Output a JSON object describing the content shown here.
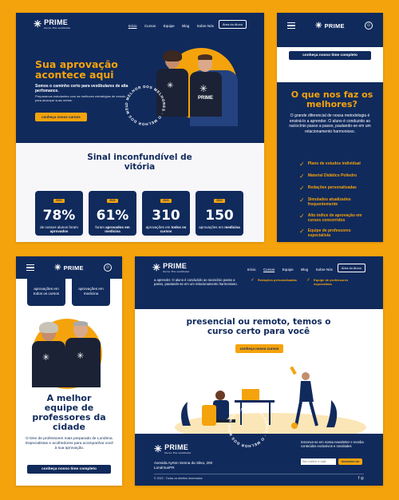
{
  "brand": {
    "name": "PRIME",
    "tagline": "Curso Pré-vestibular",
    "star": "✳"
  },
  "nav": {
    "items": [
      "Início",
      "Cursos",
      "Equipe",
      "Blog",
      "Sobre Nós"
    ],
    "cta": "Área do Aluno"
  },
  "hero": {
    "title": "Sua aprovação acontece aqui",
    "subtitle": "Somos o caminho certo para vestibulares de alta perfomance.",
    "desc": "Preparamos estudantes com as melhores estratégias de estudo para alcançar suas metas.",
    "button": "conheça nosso cursos",
    "ring_text": "O MELHOR DOS MELHORES · O MELHOR DOS MELHORES ·"
  },
  "stats": {
    "title": "Sinal inconfundível de vitória",
    "items": [
      {
        "year": "2021",
        "number": "78%",
        "caption_pre": "de nossos alunos foram",
        "caption_bold": "aprovados"
      },
      {
        "year": "2021",
        "number": "61%",
        "caption_pre": "foram",
        "caption_bold": "aprovados em medicina"
      },
      {
        "year": "2021",
        "number": "310",
        "caption_pre": "aprovações em",
        "caption_bold": "todos os cursos"
      },
      {
        "year": "2021",
        "number": "150",
        "caption_pre": "aprovações em",
        "caption_bold": "medicina"
      }
    ]
  },
  "mobile1": {
    "button": "conheça nosso time completo",
    "title": "O que nos faz os melhores?",
    "desc": "O grande diferencial de nossa metodologia é ensiná-lo a aprender. O aluno é conduzido ao raciocínio passo a passo, pautando-se em um relacionamento harmonioso.",
    "features": [
      "Plano de estudos individual",
      "Material Didático Poliedro",
      "Redações personalizadas",
      "Simulados atualizados frequentemente",
      "Alto índice de aprovação em cursos concorridos",
      "Equipe de professores especialista"
    ]
  },
  "mobile2": {
    "stat_a": "aprovações em todos os cursos",
    "stat_b": "aprovações em medicina",
    "title": "A melhor equipe de professores da cidade",
    "desc": "O time de professores mais preparado de Londrina. Especialistas e acolhedores para acompanhar você à sua aprovação.",
    "button": "conheça nosso time completo"
  },
  "desktop2": {
    "strip_text": "a aprender. O aluno é conduzido ao raciocínio passo a passo, pautando-se em um relacionamento harmonioso.",
    "strip_feat_1": "Redações personalizadas",
    "strip_feat_2": "Equipe de professores especialista",
    "title": "presencial ou remoto, temos o curso certo para você",
    "button": "conheça nosso cursos",
    "footer_address": "Avenida Ayrton Senna da Silva, 200",
    "footer_city": "Londrina/PR",
    "newsletter_title": "Inscreva-se em nossa newsletter e receba conteúdos exclusivos e novidades",
    "newsletter_placeholder": "Seu melhor e-mail",
    "newsletter_button": "Inscrever-se",
    "copyright": "© 2022 - Todos os direitos reservados",
    "social": "f ◎"
  }
}
